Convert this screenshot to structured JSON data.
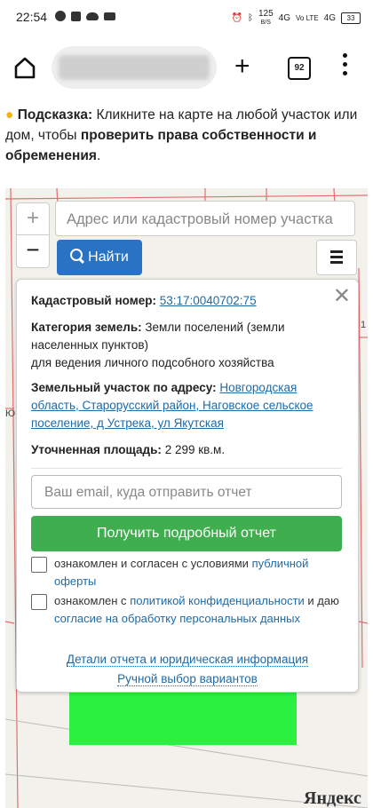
{
  "statusbar": {
    "time": "22:54",
    "network_speed": "125",
    "network_unit": "B/S",
    "signal_1": "4G",
    "signal_2": "Vo LTE",
    "signal_3": "4G",
    "battery": "33"
  },
  "browser": {
    "tab_count": "92"
  },
  "hint": {
    "icon": "lightbulb-icon",
    "label": "Подсказка:",
    "text_1": " Кликните на карте на любой участок или дом, чтобы ",
    "text_bold": "проверить права собственности и обременения",
    "text_end": "."
  },
  "map": {
    "zoom_in": "+",
    "zoom_out": "−",
    "search_placeholder": "Адрес или кадастровый номер участка",
    "find_button": "Найти",
    "label_left": "Ю",
    "label_right": "1",
    "yandex": "Яндекс",
    "plot_color": "#2bf03f"
  },
  "popup": {
    "cadastral_label": "Кадастровый номер:",
    "cadastral_value": "53:17:0040702:75",
    "category_label": "Категория земель:",
    "category_value": "Земли поселений (земли населенных пунктов)",
    "category_use": "для ведения личного подсобного хозяйства",
    "address_label": "Земельный участок по адресу:",
    "address_value": "Новгородская область, Старорусский район, Наговское сельское поселение, д Устрека, ул Якутская",
    "area_label": "Уточненная площадь:",
    "area_value": "2 299 кв.м.",
    "email_placeholder": "Ваш email, куда отправить отчет",
    "report_button": "Получить подробный отчет",
    "consent_1_text": "ознакомлен и согласен с условиями ",
    "consent_1_link": "публичной оферты",
    "consent_2_text_a": "ознакомлен с ",
    "consent_2_link_a": "политикой конфиденциальности",
    "consent_2_text_b": " и даю ",
    "consent_2_link_b": "согласие на обработку персональных данных",
    "details_link": "Детали отчета и юридическая информация",
    "manual_link": "Ручной выбор вариантов"
  }
}
